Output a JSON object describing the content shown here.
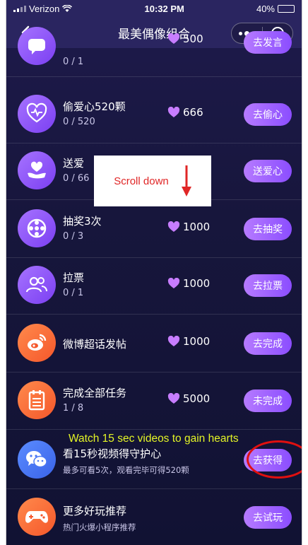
{
  "status_bar": {
    "carrier": "Verizon",
    "time": "10:32 PM",
    "battery": "40%",
    "battery_level": 0.4
  },
  "nav": {
    "title": "最美偶像组合"
  },
  "tasks": [
    {
      "icon": "chat-bubble-icon",
      "color": "purple",
      "title": "",
      "progress": "0 / 1",
      "points": "500",
      "button": "去发言"
    },
    {
      "icon": "heart-hand-icon",
      "color": "purple",
      "title": "偷爱心520颗",
      "progress": "0 / 520",
      "points": "666",
      "button": "去偷心"
    },
    {
      "icon": "give-heart-icon",
      "color": "purple",
      "title": "送爱",
      "progress": "0 / 66",
      "points": "",
      "button": "送爱心"
    },
    {
      "icon": "wheel-icon",
      "color": "purple",
      "title": "抽奖3次",
      "progress": "0 / 3",
      "points": "1000",
      "button": "去抽奖"
    },
    {
      "icon": "group-icon",
      "color": "purple",
      "title": "拉票",
      "progress": "0 / 1",
      "points": "1000",
      "button": "去拉票"
    },
    {
      "icon": "weibo-icon",
      "color": "orange",
      "title": "微博超话发帖",
      "progress": "",
      "points": "1000",
      "button": "去完成"
    },
    {
      "icon": "notepad-icon",
      "color": "orange",
      "title": "完成全部任务",
      "progress": "1 / 8",
      "points": "5000",
      "button": "未完成"
    },
    {
      "icon": "wechat-icon",
      "color": "blue",
      "title": "看15秒视频得守护心",
      "progress": "最多可看5次，观看完毕可得520颗",
      "points": "",
      "button": "去获得"
    },
    {
      "icon": "gamepad-icon",
      "color": "orange",
      "title": "更多好玩推荐",
      "progress": "热门火爆小程序推荐",
      "points": "",
      "button": "去试玩"
    }
  ],
  "overlay": {
    "scroll_hint": "Scroll down",
    "annotation": "Watch 15 sec videos to gain hearts"
  },
  "colors": {
    "button_gradient_start": "#b67bff",
    "button_gradient_end": "#8b4dff",
    "heart": "#c77dff",
    "annotation": "#e4f526",
    "highlight_ring": "#e01010"
  }
}
